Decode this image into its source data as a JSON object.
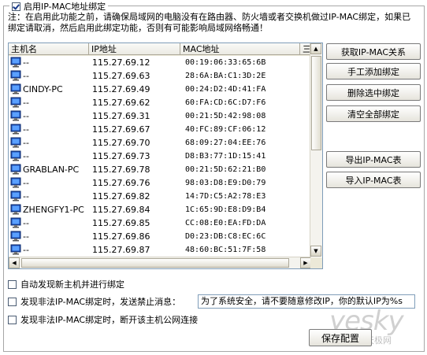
{
  "group": {
    "title": "启用IP-MAC地址绑定",
    "checked": true,
    "note": "注：在启用此功能之前，请确保局域网的电脑没有在路由器、防火墙或者交换机做过IP-MAC绑定，如果已绑定请取消，然后启用此绑定功能，否则有可能影响局域网络畅通！"
  },
  "table": {
    "columns": [
      "主机名",
      "IP地址",
      "MAC地址",
      "三"
    ],
    "rows": [
      {
        "host": "--",
        "ip": "115.27.69.12",
        "mac": "00:19:06:33:65:6B"
      },
      {
        "host": "--",
        "ip": "115.27.69.63",
        "mac": "28:6A:BA:C1:3D:2E"
      },
      {
        "host": "CINDY-PC",
        "ip": "115.27.69.49",
        "mac": "00:24:D2:4D:41:FA"
      },
      {
        "host": "--",
        "ip": "115.27.69.62",
        "mac": "60:FA:CD:6C:D7:F6"
      },
      {
        "host": "--",
        "ip": "115.27.69.31",
        "mac": "00:21:5D:42:98:08"
      },
      {
        "host": "--",
        "ip": "115.27.69.67",
        "mac": "40:FC:89:CF:06:12"
      },
      {
        "host": "--",
        "ip": "115.27.69.70",
        "mac": "68:09:27:04:EE:76"
      },
      {
        "host": "--",
        "ip": "115.27.69.73",
        "mac": "D8:B3:77:1D:15:41"
      },
      {
        "host": "GRABLAN-PC",
        "ip": "115.27.69.78",
        "mac": "00:21:5D:62:21:B0"
      },
      {
        "host": "--",
        "ip": "115.27.69.76",
        "mac": "98:03:D8:E9:D0:79"
      },
      {
        "host": "--",
        "ip": "115.27.69.82",
        "mac": "14:7D:C5:A2:78:E3"
      },
      {
        "host": "ZHENGFY1-PC",
        "ip": "115.27.69.84",
        "mac": "1C:65:9D:E8:D9:B4"
      },
      {
        "host": "--",
        "ip": "115.27.69.85",
        "mac": "CC:08:E0:EA:FD:DA"
      },
      {
        "host": "--",
        "ip": "115.27.69.86",
        "mac": "D0:23:DB:C8:EC:6C"
      },
      {
        "host": "--",
        "ip": "115.27.69.87",
        "mac": "48:60:BC:51:7F:58"
      }
    ]
  },
  "buttons": {
    "get_relation": "获取IP-MAC关系",
    "manual_add": "手工添加绑定",
    "delete_selected": "删除选中绑定",
    "clear_all": "清空全部绑定",
    "export": "导出IP-MAC表",
    "import": "导入IP-MAC表",
    "save": "保存配置"
  },
  "options": {
    "auto_discover": {
      "label": "自动发现新主机并进行绑定",
      "checked": false
    },
    "send_ban_message": {
      "label": "发现非法IP-MAC绑定时，发送禁止消息：",
      "checked": false,
      "message": "为了系统安全，请不要随意修改IP，你的默认IP为%s"
    },
    "disconnect_host": {
      "label": "发现非法IP-MAC绑定时，断开该主机公网连接",
      "checked": false
    }
  },
  "watermark": {
    "text": "yesky",
    "sub": "天极网"
  },
  "icons": {
    "row_icon": "computer-icon"
  }
}
